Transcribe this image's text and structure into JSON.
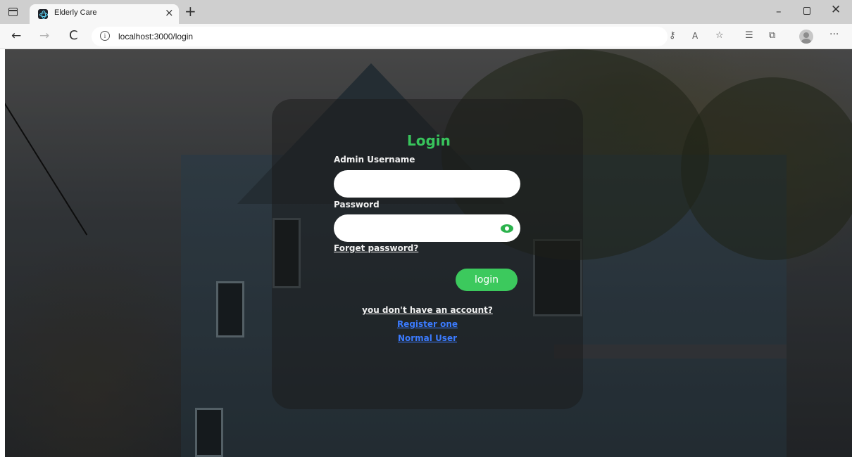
{
  "browser": {
    "tab_title": "Elderly Care",
    "tab_close": "×",
    "new_tab": "+",
    "url": "localhost:3000/login",
    "icons": {
      "sidebar_toggle": "window-layout-icon",
      "favicon": "react-icon",
      "back": "back-arrow-icon",
      "forward": "forward-arrow-icon",
      "reload": "reload-icon",
      "info": "info-icon",
      "key": "key-icon",
      "read_aloud": "read-aloud-icon",
      "favorite": "favorite-star-icon",
      "favorites": "favorites-list-icon",
      "collections": "collections-icon",
      "profile": "profile-avatar-icon",
      "more": "more-icon"
    },
    "glyphs": {
      "back": "←",
      "forward": "→",
      "reload": "C",
      "info": "i",
      "key": "⚷",
      "read": "A",
      "fav": "☆",
      "favs": "☰",
      "coll": "⧉",
      "more": "···",
      "min": "–",
      "close": "✕"
    }
  },
  "login": {
    "title": "Login",
    "username_label": "Admin Username",
    "username_value": "",
    "password_label": "Password",
    "password_value": "",
    "forgot_link": "Forget password?",
    "login_button": "login",
    "no_account_text": "you don't have an account?",
    "register_link": "Register one",
    "normal_user_link": "Normal User"
  },
  "colors": {
    "accent_green": "#3cc95d",
    "title_green": "#38c45c",
    "link_blue": "#3b7bff"
  }
}
